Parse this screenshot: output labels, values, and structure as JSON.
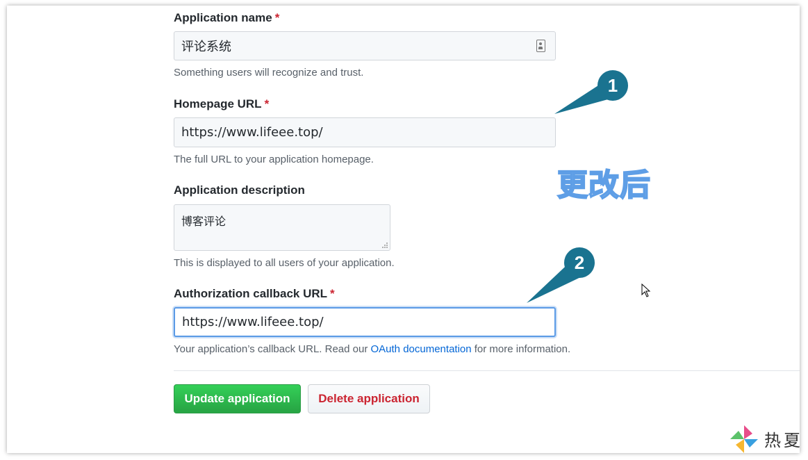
{
  "form": {
    "app_name": {
      "label": "Application name",
      "required_mark": "*",
      "value": "评论系统",
      "help": "Something users will recognize and trust."
    },
    "homepage_url": {
      "label": "Homepage URL",
      "required_mark": "*",
      "value": "https://www.lifeee.top/",
      "help": "The full URL to your application homepage."
    },
    "description": {
      "label": "Application description",
      "value": "博客评论",
      "help": "This is displayed to all users of your application."
    },
    "callback_url": {
      "label": "Authorization callback URL",
      "required_mark": "*",
      "value": "https://www.lifeee.top/",
      "help_before": "Your application’s callback URL. Read our ",
      "help_link": "OAuth documentation",
      "help_after": " for more information."
    }
  },
  "buttons": {
    "update": "Update application",
    "delete": "Delete application"
  },
  "annotations": {
    "marker_1": "1",
    "marker_2": "2",
    "changed_label": "更改后",
    "marker_color": "#1a7390"
  },
  "watermark": {
    "text": "热夏"
  },
  "colors": {
    "required": "#cb2431",
    "link": "#0366d6",
    "primary_button": "#28a745",
    "danger_text": "#cb2431"
  }
}
